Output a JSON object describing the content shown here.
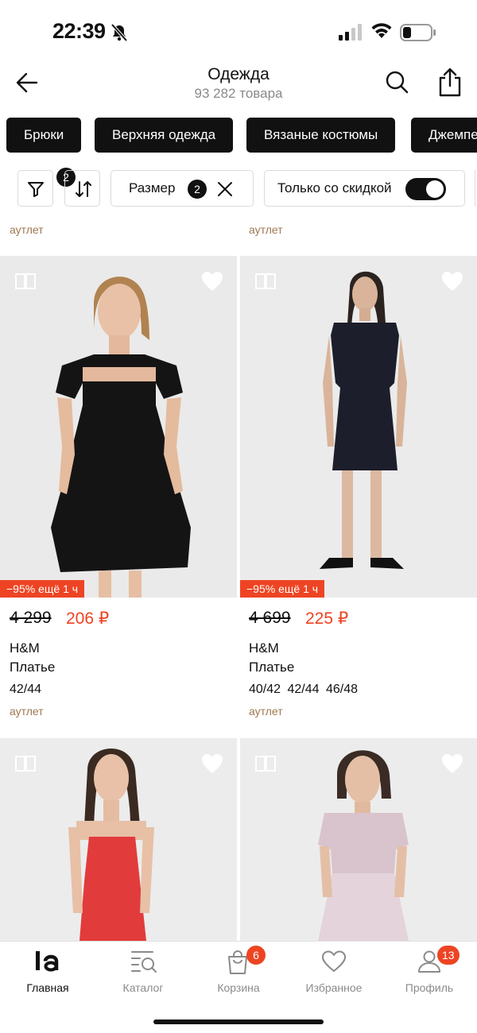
{
  "status_bar": {
    "time": "22:39"
  },
  "header": {
    "title": "Одежда",
    "subtitle": "93 282 товара"
  },
  "categories": [
    "Брюки",
    "Верхняя одежда",
    "Вязаные костюмы",
    "Джемпе"
  ],
  "filters": {
    "filter_count": "2",
    "size_label": "Размер",
    "size_count": "2",
    "discount_label": "Только со скидкой",
    "discount_enabled": true
  },
  "top_labels": [
    "аутлет",
    "аутлет"
  ],
  "products": [
    {
      "promo": "−95% ещё 1 ч",
      "old_price": "4 299",
      "new_price": "206 ₽",
      "brand": "H&M",
      "type": "Платье",
      "sizes": "42/44",
      "label": "аутлет"
    },
    {
      "promo": "−95% ещё 1 ч",
      "old_price": "4 699",
      "new_price": "225 ₽",
      "brand": "H&M",
      "type": "Платье",
      "sizes": "40/42 42/44 46/48",
      "label": "аутлет"
    }
  ],
  "tabs": [
    {
      "label": "Главная",
      "icon": "la-logo-icon"
    },
    {
      "label": "Каталог",
      "icon": "catalog-search-icon"
    },
    {
      "label": "Корзина",
      "icon": "shopping-bag-icon",
      "badge": "6"
    },
    {
      "label": "Избранное",
      "icon": "heart-icon"
    },
    {
      "label": "Профиль",
      "icon": "profile-icon",
      "badge": "13"
    }
  ],
  "colors": {
    "accent": "#ee4423",
    "chip_bg": "#111111",
    "outlet_text": "#a07850",
    "muted": "#8a8a8a"
  }
}
